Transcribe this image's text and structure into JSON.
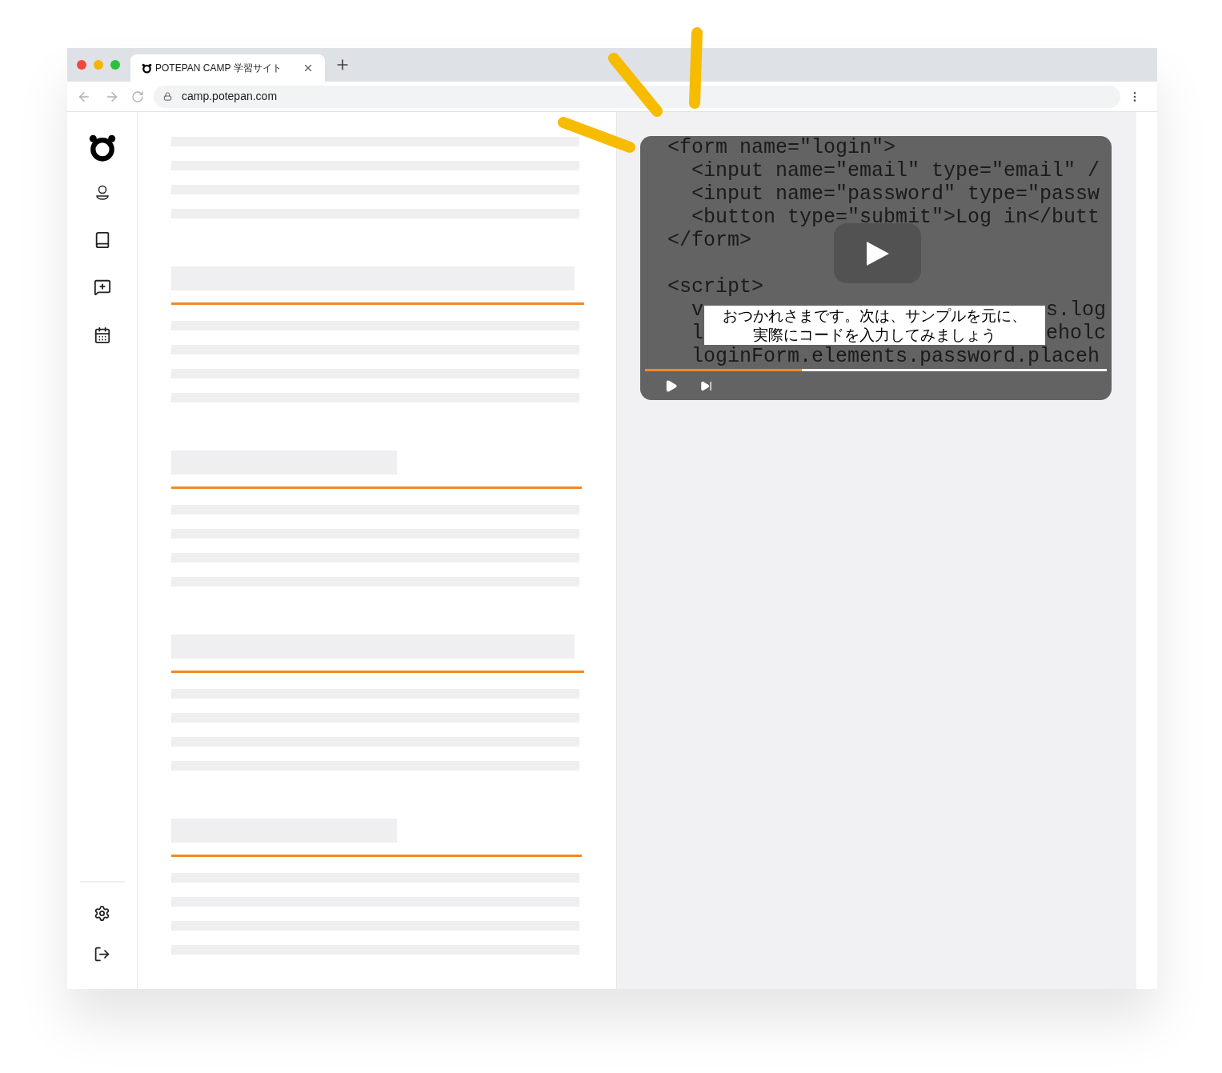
{
  "browser": {
    "tab": {
      "title": "POTEPAN CAMP 学習サイト",
      "selected": true
    },
    "url": "camp.potepan.com"
  },
  "video": {
    "code_lines": [
      {
        "kind": "code",
        "text": "<form name=\"login\">"
      },
      {
        "kind": "code",
        "text": "  <input name=\"email\" type=\"email\" /"
      },
      {
        "kind": "code",
        "text": "  <input name=\"password\" type=\"passw"
      },
      {
        "kind": "code",
        "text": "  <button type=\"submit\">Log in</butt"
      },
      {
        "kind": "code",
        "text": "</form>"
      },
      {
        "kind": "blank"
      },
      {
        "kind": "code",
        "text": "<script>"
      },
      {
        "kind": "split",
        "left": "  v",
        "right": "s.log"
      },
      {
        "kind": "split",
        "left": "  l",
        "right": "eholc"
      },
      {
        "kind": "code",
        "text": "  loginForm.elements.password.placeh"
      }
    ],
    "caption_lines": [
      "おつかれさまです。次は、サンプルを元に、",
      "実際にコードを入力してみましょう"
    ],
    "progress": {
      "level": 0.34
    }
  }
}
